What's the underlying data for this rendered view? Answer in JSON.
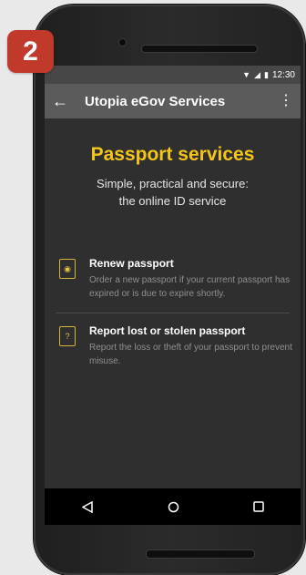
{
  "badge": "2",
  "status_bar": {
    "time": "12:30"
  },
  "app_bar": {
    "title": "Utopia eGov Services"
  },
  "hero": {
    "title": "Passport services",
    "subtitle_line1": "Simple, practical and secure:",
    "subtitle_line2": "the online ID service"
  },
  "services": [
    {
      "title": "Renew passport",
      "description": "Order a new passport if your current passport has expired or is due to expire shortly."
    },
    {
      "title": "Report lost or stolen passport",
      "description": "Report the loss or theft of your passport to prevent misuse."
    }
  ],
  "colors": {
    "accent": "#f5c518",
    "badge": "#c0392b"
  },
  "icons": {
    "back": "arrow-back-icon",
    "overflow": "more-vert-icon",
    "renew": "globe-passport-icon",
    "report": "question-passport-icon",
    "nav_back": "triangle-back-icon",
    "nav_home": "circle-home-icon",
    "nav_recents": "square-recents-icon"
  }
}
